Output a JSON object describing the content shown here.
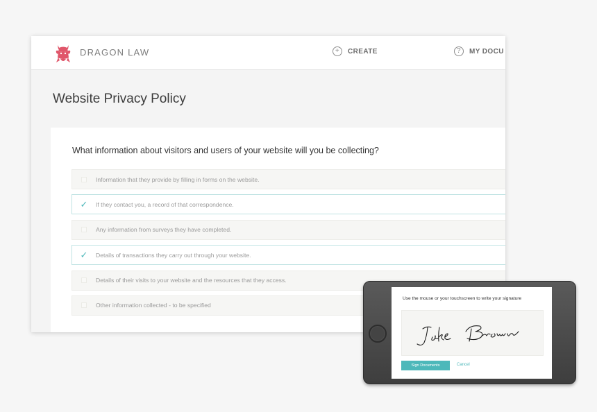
{
  "header": {
    "brand": "DRAGON LAW",
    "nav": [
      {
        "label": "CREATE",
        "icon": "plus-circle-icon"
      },
      {
        "label": "MY DOCU",
        "icon": "question-circle-icon"
      }
    ]
  },
  "page": {
    "title": "Website Privacy Policy",
    "question": "What information about visitors and users of your website will you be collecting?",
    "options": [
      {
        "label": "Information that they provide by filling in forms on the website.",
        "checked": false
      },
      {
        "label": "If they contact you, a record of that correspondence.",
        "checked": true
      },
      {
        "label": "Any information from surveys they have completed.",
        "checked": false
      },
      {
        "label": "Details of transactions they carry out through your website.",
        "checked": true
      },
      {
        "label": "Details of their visits to your website and the resources that they access.",
        "checked": false
      },
      {
        "label": "Other information collected - to be specified",
        "checked": false
      }
    ]
  },
  "signature": {
    "prompt": "Use the mouse or your touchscreen to write your signature",
    "signed_name": "Jake Brown",
    "sign_button": "Sign Documents",
    "cancel": "Cancel"
  },
  "colors": {
    "accent": "#4db8ba",
    "logo": "#e0566a",
    "background": "#f6f6f6"
  }
}
